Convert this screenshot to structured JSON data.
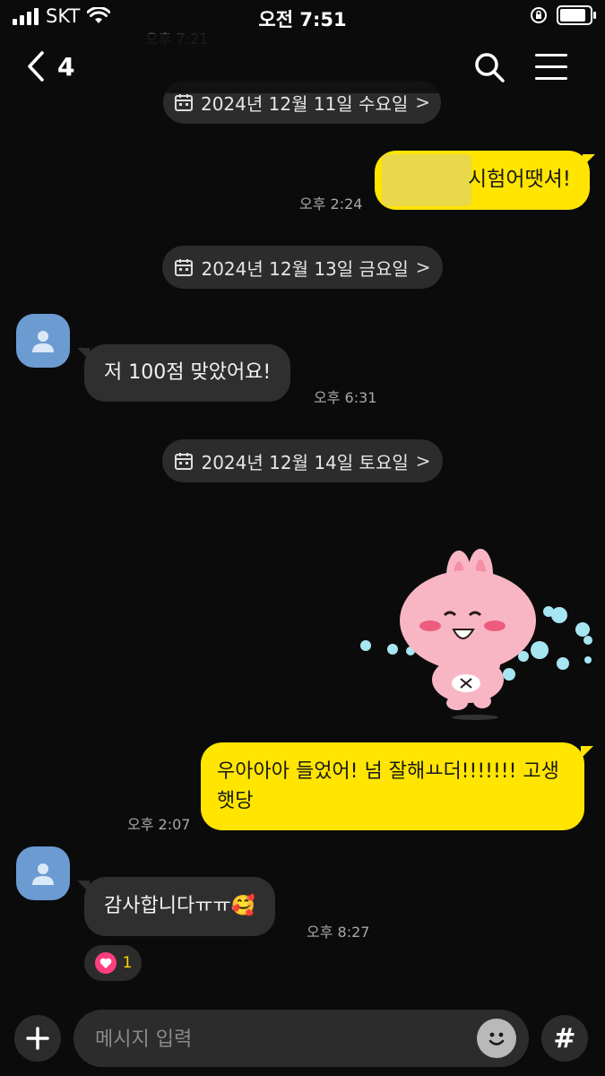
{
  "status_bar": {
    "carrier": "SKT",
    "time": "오전 7:51",
    "battery_level": 0.9
  },
  "header": {
    "back_count": "4",
    "icons": [
      "chevron-left-icon",
      "search-icon",
      "menu-icon"
    ]
  },
  "faded_time": "오후 7:21",
  "messages": {
    "date1": "2024년 12월 11일 수요일",
    "out1_text": "시험어땟셔!",
    "out1_time": "오후 2:24",
    "date2": "2024년 12월 13일 금요일",
    "in1_text": "저 100점 맞았어요!",
    "in1_time": "오후 6:31",
    "date3": "2024년 12월 14일 토요일",
    "out2_text": "우아아아 들었어! 넘 잘해ㅛ더!!!!!!! 고생햇당",
    "out2_time": "오후 2:07",
    "in2_text": "감사합니다ㅠㅠ🥰",
    "in2_time": "오후 8:27",
    "reaction_count": "1"
  },
  "composer": {
    "placeholder": "메시지 입력"
  },
  "colors": {
    "background": "#0b0b0b",
    "outgoing_bubble": "#ffe500",
    "incoming_bubble": "#2f2f2f",
    "avatar": "#6b9bd1",
    "reaction_heart": "#ff3d7f",
    "sticker_pink": "#f8b6c4"
  }
}
